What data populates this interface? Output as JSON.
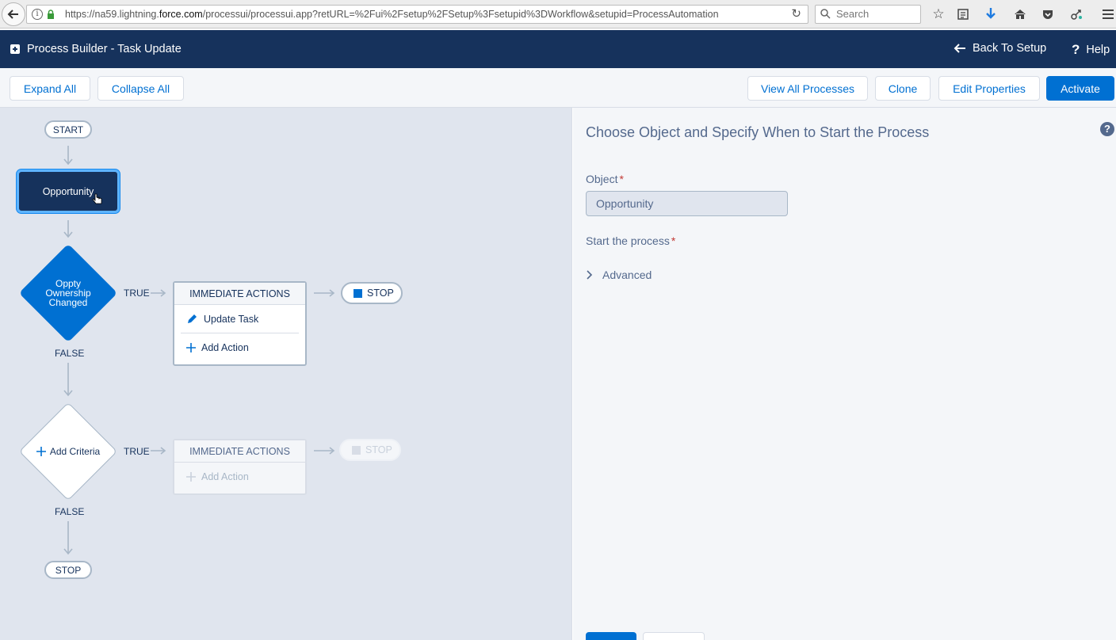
{
  "browser": {
    "url_prefix": "https://na59.lightning.",
    "url_domain": "force.com",
    "url_suffix": "/processui/processui.app?retURL=%2Fui%2Fsetup%2FSetup%3Fsetupid%3DWorkflow&setupid=ProcessAutomation",
    "search_placeholder": "Search"
  },
  "header": {
    "app_title": "Process Builder - Task Update",
    "back_to_setup": "Back To Setup",
    "help": "Help"
  },
  "toolbar": {
    "expand_all": "Expand All",
    "collapse_all": "Collapse All",
    "view_all_processes": "View All Processes",
    "clone": "Clone",
    "edit_properties": "Edit Properties",
    "activate": "Activate"
  },
  "canvas": {
    "start": "START",
    "object_node": "Opportunity",
    "criteria1": {
      "line1": "Oppty",
      "line2": "Ownership",
      "line3": "Changed",
      "true_label": "TRUE",
      "false_label": "FALSE",
      "actions_header": "IMMEDIATE ACTIONS",
      "action1": "Update Task",
      "add_action": "Add Action",
      "stop": "STOP"
    },
    "criteria2": {
      "label": "Add Criteria",
      "true_label": "TRUE",
      "false_label": "FALSE",
      "actions_header": "IMMEDIATE ACTIONS",
      "add_action": "Add Action",
      "stop": "STOP"
    },
    "end_stop": "STOP"
  },
  "panel": {
    "title": "Choose Object and Specify When to Start the Process",
    "object_label": "Object",
    "object_value": "Opportunity",
    "start_label": "Start the process",
    "advanced": "Advanced",
    "required_mark": "*"
  }
}
